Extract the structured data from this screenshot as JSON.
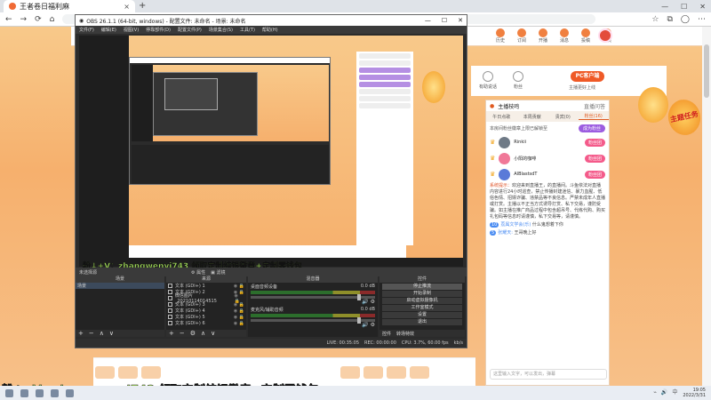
{
  "browser": {
    "tab_title": "王者卷日福利麻",
    "tab_close": "×",
    "new_tab": "+",
    "nav_back": "←",
    "nav_forward": "→",
    "nav_reload": "⟳",
    "nav_home": "⌂",
    "win_min": "—",
    "win_max": "☐",
    "win_close": "✕"
  },
  "site": {
    "header_icons": [
      "历史",
      "订阅",
      "开播",
      "消息",
      "投稿",
      "会员"
    ],
    "anchor_stats": [
      {
        "label": "有助说话"
      },
      {
        "label": "粉丝"
      }
    ],
    "pc_button": "PC客户端",
    "pc_sub": "主播更好上线",
    "task_badge": "主题任务",
    "chat": {
      "title": "主播枝鸣",
      "title_right": "直播问答",
      "tabs": [
        "午日点歌",
        "本周贡献",
        "贵宾(0)",
        "粉丝(16)"
      ],
      "active_tab": 3,
      "info": "本房间粉丝徽章上限已解锁至",
      "info_button": "成为粉丝",
      "ranks": [
        {
          "name": "Rinkii",
          "badge": "粉丝团",
          "color": "#6f7a86"
        },
        {
          "name": "小阳的咖啡",
          "badge": "粉丝团",
          "color": "#f07898"
        },
        {
          "name": "AlBlastsdT",
          "badge": "粉丝团",
          "color": "#5a7ad8"
        }
      ],
      "system_label": "系统提示：",
      "system_msg": "欢迎来到直播王，的直播间。斗鱼依法对直播内容进行24小时巡查，禁止传播封建迷信、暴力血腥、低俗色情、招嫖诈骗、违禁品等不良信息。严禁未成年人直播或打赏。主播以不正当方式诱导打赏、私下交易，谨防受骗。如主播在推广商品过程中包含超吊号、代练代购、购买礼包码等信息时请谨慎，私下交易等，请谨慎。",
      "messages": [
        {
          "level": "10",
          "user": "荔属文学会(乐)",
          "text": "什么鬼想着下你"
        },
        {
          "level": "5",
          "user": "张耀天:",
          "text": "王哥晚上好"
        }
      ],
      "input_placeholder": "这里输入文字，可以发出，弹幕"
    }
  },
  "obs": {
    "title": "OBS 26.1.1 (64-bit, windows) - 配置文件: 未命名 - 场景: 未命名",
    "menu": [
      "文件(F)",
      "编辑(E)",
      "视图(V)",
      "停靠部件(D)",
      "配置文件(P)",
      "场景集合(S)",
      "工具(T)",
      "帮助(H)"
    ],
    "preview_caption": "粉↓+V：zhangwenyi743 领取定制纯银徽章+定制零钱包",
    "stat_left": "未选择源",
    "stat_props": "属性",
    "stat_filters": "滤镜",
    "docks": {
      "scenes_header": "场景",
      "scenes": [
        "场景"
      ],
      "sources_header": "来源",
      "sources": [
        "文本 (GDI+) 1",
        "文本 (GDI+) 2",
        "微信图片_20210114014515",
        "文本 (GDI+) 3",
        "文本 (GDI+) 4",
        "文本 (GDI+) 5",
        "文本 (GDI+) 6"
      ],
      "mixer_header": "混音器",
      "tracks": [
        {
          "name": "桌面音频设备",
          "db": "0.0 dB"
        },
        {
          "name": "麦克风/辅助音频",
          "db": "0.0 dB"
        }
      ],
      "controls_header": "控件",
      "controls": [
        "停止推流",
        "开始录制",
        "启动虚拟摄像机",
        "工作室模式",
        "设置",
        "退出"
      ],
      "tabs": [
        "控件",
        "转场特效"
      ]
    },
    "status": {
      "live": "LIVE: 00:35:05",
      "rec": "REC: 00:00:00",
      "cpu": "CPU: 3.7%, 60.00 fps",
      "dropped": "kb/s"
    }
  },
  "overlay": {
    "caption": "粉↓+V：zhangwenyi743 领取定制纯银徽章+定制零钱包"
  },
  "taskbar": {
    "clock_time": "19:05",
    "clock_date": "2022/3/31",
    "lang": "中"
  }
}
